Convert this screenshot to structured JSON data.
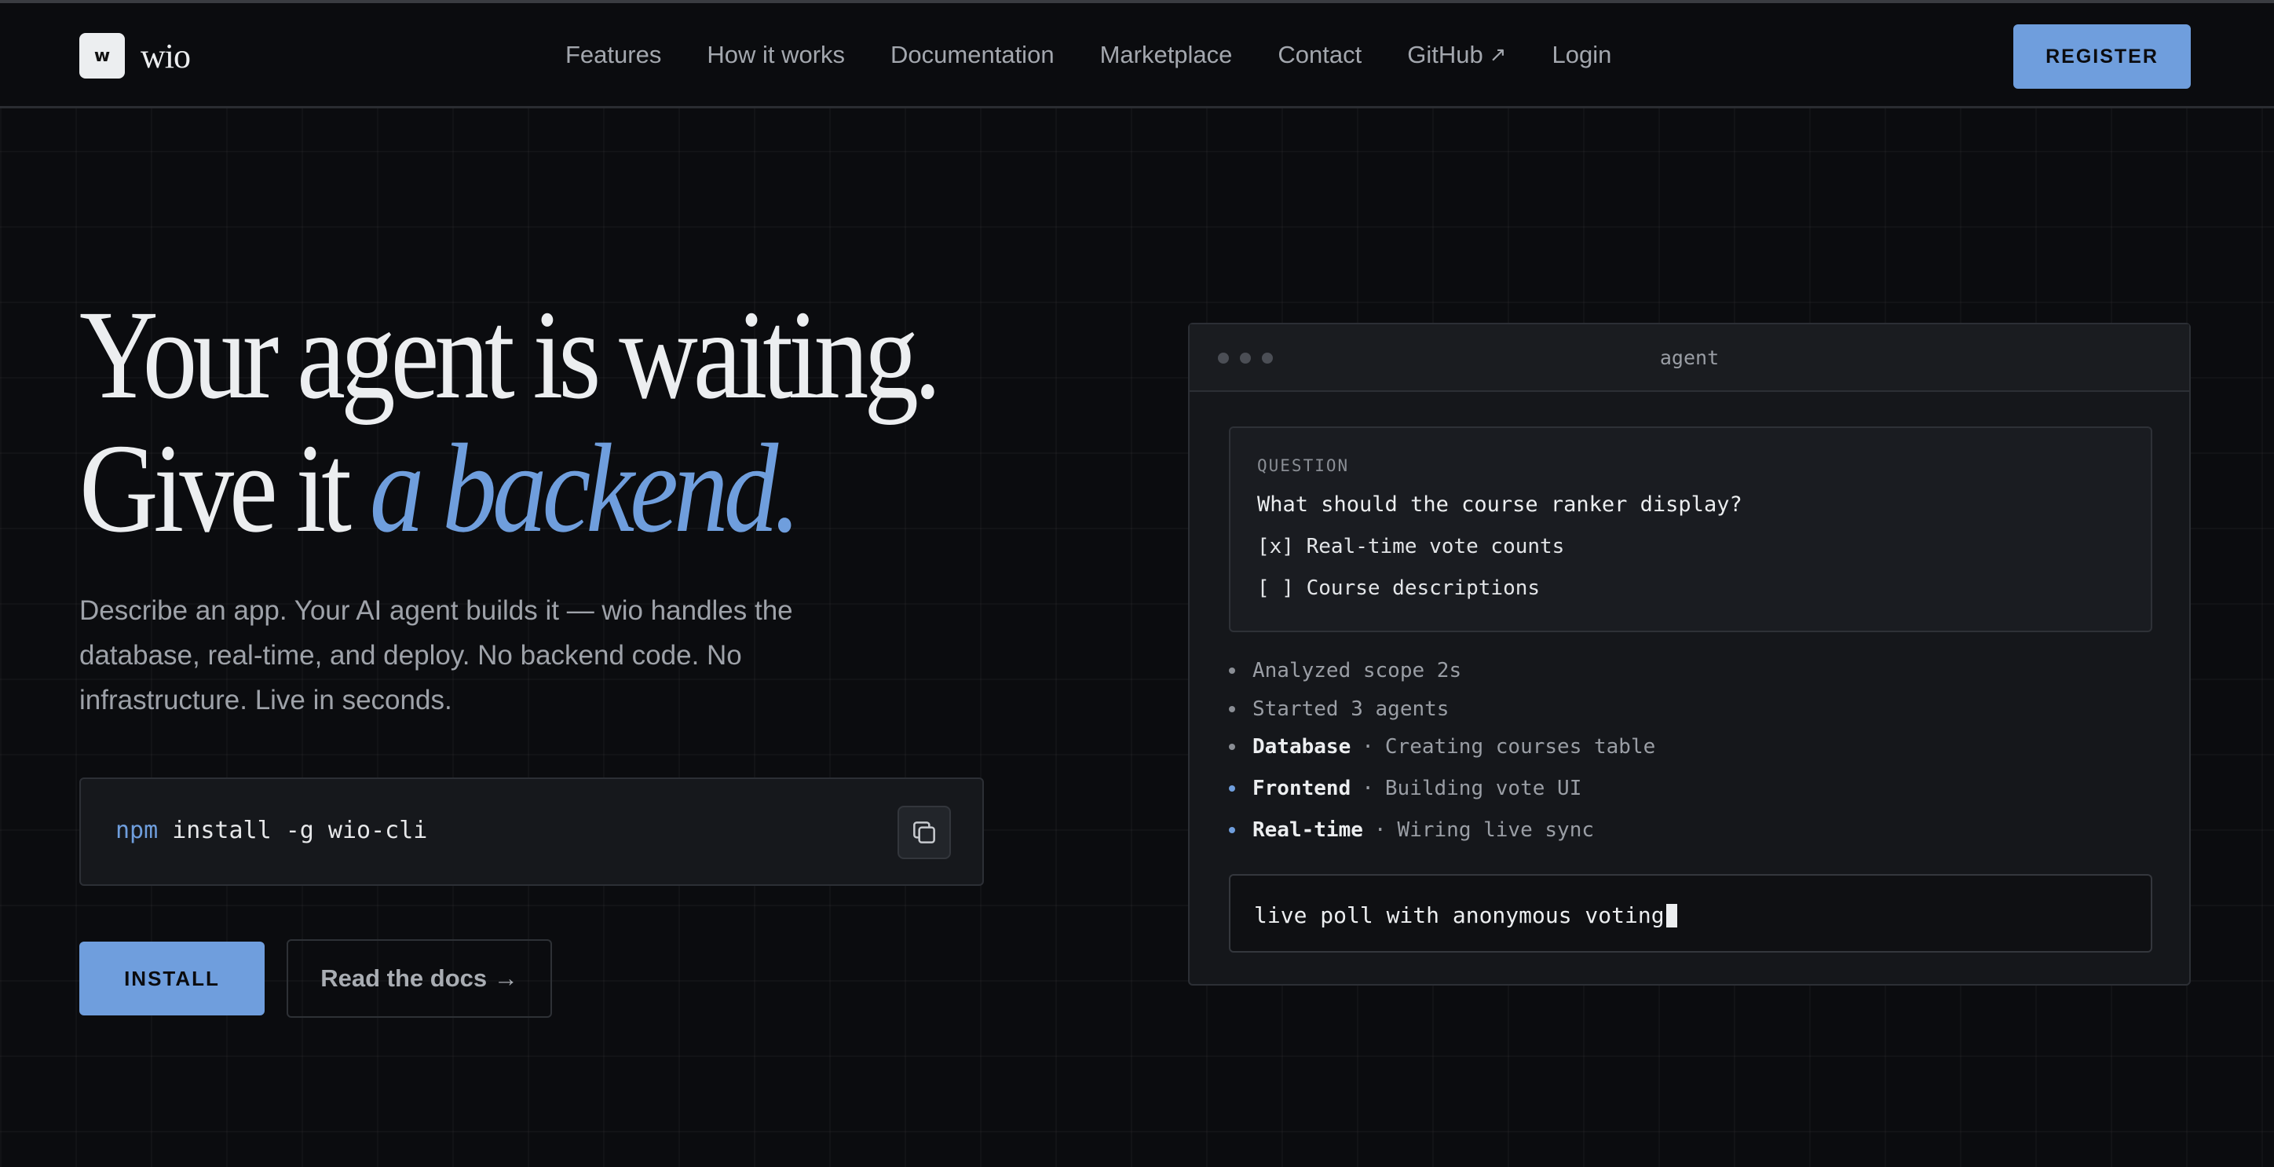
{
  "header": {
    "logo_mark": "w",
    "logo_text": "wio",
    "nav": [
      {
        "label": "Features"
      },
      {
        "label": "How it works"
      },
      {
        "label": "Documentation"
      },
      {
        "label": "Marketplace"
      },
      {
        "label": "Contact"
      },
      {
        "label": "GitHub",
        "icon": "external-arrow-icon"
      },
      {
        "label": "Login"
      }
    ],
    "register_label": "REGISTER"
  },
  "hero": {
    "line1": "Your agent is waiting.",
    "line2_plain": "Give it ",
    "line2_accent": "a backend.",
    "subtitle": "Describe an app. Your AI agent builds it — wio handles the database, real-time, and deploy. No backend code. No infrastructure. Live in seconds.",
    "command_prefix": "npm",
    "command_rest": " install -g wio-cli",
    "copy_icon": "copy-icon",
    "install_label": "INSTALL",
    "docs_label": "Read the docs →"
  },
  "agent_panel": {
    "title": "agent",
    "question": {
      "label": "QUESTION",
      "text": "What should the course ranker display?",
      "options": [
        "[x] Real-time vote counts",
        "[ ] Course descriptions"
      ]
    },
    "log": [
      {
        "text": "Analyzed scope 2s"
      },
      {
        "text": "Started 3 agents"
      },
      {
        "name": "Database",
        "sep": "·",
        "detail": "Creating courses table"
      },
      {
        "name": "Frontend",
        "sep": "·",
        "detail": "Building vote UI"
      },
      {
        "name": "Real-time",
        "sep": "·",
        "detail": "Wiring live sync"
      }
    ],
    "input_value": "live poll with anonymous voting"
  },
  "colors": {
    "background": "#0b0c0f",
    "accent": "#6f9edd",
    "text": "#eceef0",
    "muted": "#9ea2a9"
  }
}
